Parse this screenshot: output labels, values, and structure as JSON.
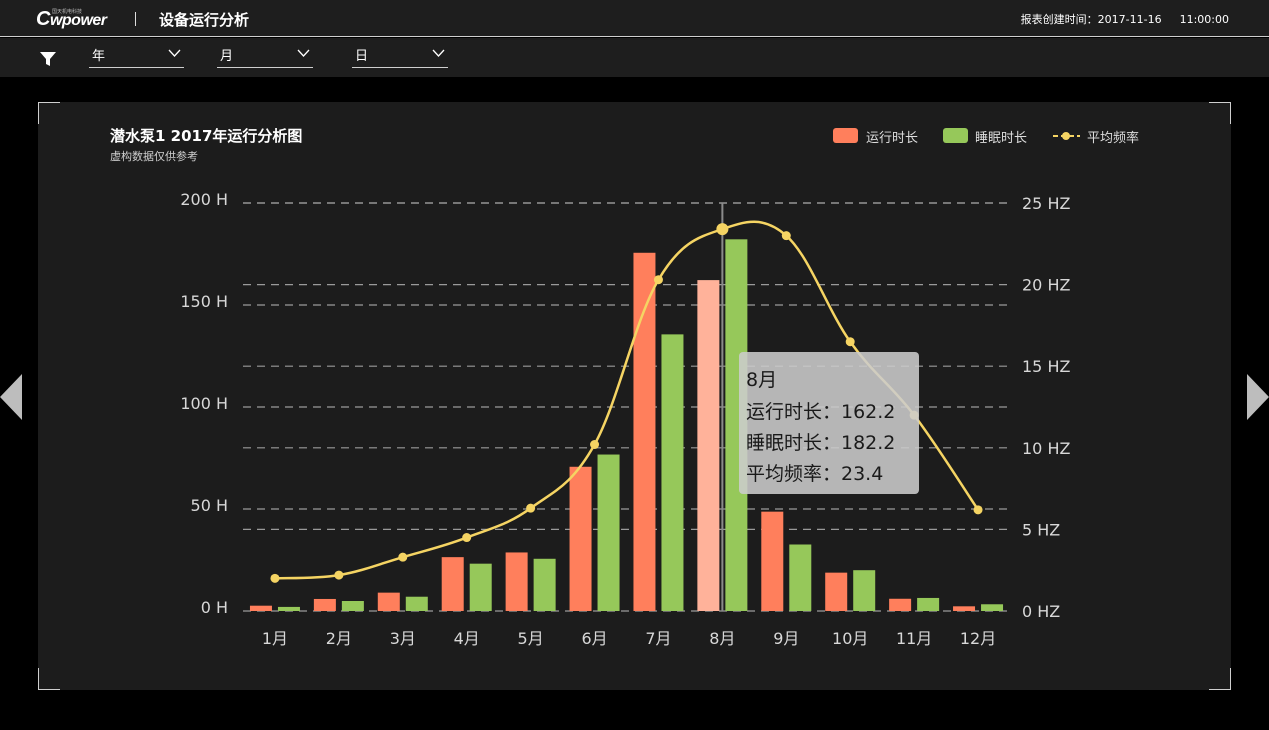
{
  "header": {
    "logo_text": "wpower",
    "logo_tagline": "国天机电科技",
    "title": "设备运行分析",
    "report_time_label": "报表创建时间：",
    "report_date": "2017-11-16",
    "report_clock": "11:00:00"
  },
  "filters": {
    "year_label": "年",
    "month_label": "月",
    "day_label": "日"
  },
  "nav": {
    "prev_icon": "triangle-left-icon",
    "next_icon": "triangle-right-icon"
  },
  "colors": {
    "run": "#ff7f5c",
    "sleep": "#96c85a",
    "freq": "#f5d463",
    "highlight": "#ffb29a"
  },
  "chart_data": {
    "type": "bar",
    "title": "潜水泵1 2017年运行分析图",
    "subtitle": "虚构数据仅供参考",
    "categories": [
      "1月",
      "2月",
      "3月",
      "4月",
      "5月",
      "6月",
      "7月",
      "8月",
      "9月",
      "10月",
      "11月",
      "12月"
    ],
    "series": [
      {
        "name": "运行时长",
        "type": "bar",
        "axis": "left",
        "values": [
          2.6,
          5.9,
          9.0,
          26.4,
          28.7,
          70.7,
          175.6,
          162.2,
          48.7,
          18.8,
          6.0,
          2.3
        ]
      },
      {
        "name": "睡眠时长",
        "type": "bar",
        "axis": "left",
        "values": [
          2.0,
          4.9,
          7.0,
          23.2,
          25.6,
          76.7,
          135.6,
          182.2,
          32.6,
          20.0,
          6.4,
          3.3
        ]
      },
      {
        "name": "平均频率",
        "type": "line",
        "axis": "right",
        "values": [
          2.0,
          2.2,
          3.3,
          4.5,
          6.3,
          10.2,
          20.3,
          23.4,
          23.0,
          16.5,
          12.0,
          6.2
        ]
      }
    ],
    "left_axis": {
      "ticks": [
        "0 H",
        "50 H",
        "100 H",
        "150 H",
        "200 H"
      ],
      "ylim": [
        0,
        200
      ]
    },
    "right_axis": {
      "ticks": [
        "0 HZ",
        "5 HZ",
        "10 HZ",
        "15 HZ",
        "20 HZ",
        "25 HZ"
      ],
      "ylim": [
        0,
        25
      ]
    },
    "legend": {
      "items": [
        "运行时长",
        "睡眠时长",
        "平均频率"
      ],
      "position": "top-right"
    },
    "grid": true,
    "tooltip": {
      "category": "8月",
      "lines": [
        "运行时长：162.2",
        "睡眠时长：182.2",
        "平均频率：23.4"
      ]
    }
  }
}
